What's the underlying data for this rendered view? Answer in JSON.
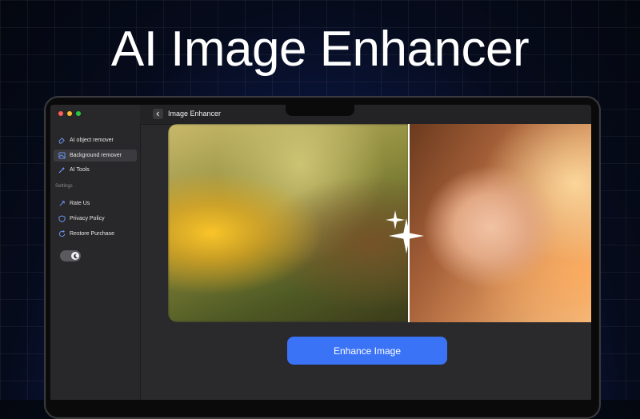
{
  "headline": "AI Image Enhancer",
  "sidebar": {
    "items": [
      {
        "label": "AI object remover",
        "icon": "eraser-icon"
      },
      {
        "label": "Background remover",
        "icon": "image-icon",
        "active": true
      },
      {
        "label": "AI Tools",
        "icon": "magic-wand-icon"
      }
    ],
    "section_label": "Settings",
    "settings_items": [
      {
        "label": "Rate Us",
        "icon": "rate-icon"
      },
      {
        "label": "Privacy Policy",
        "icon": "shield-icon"
      },
      {
        "label": "Restore Purchase",
        "icon": "restore-icon"
      }
    ],
    "theme_toggle": {
      "icon": "moon-icon",
      "state": "on"
    }
  },
  "topbar": {
    "title": "Image Enhancer",
    "back_icon": "chevron-left-icon"
  },
  "main": {
    "enhance_button": "Enhance Image"
  },
  "colors": {
    "accent": "#3b73f7",
    "traffic_red": "#ff5f57",
    "traffic_yellow": "#febc2e",
    "traffic_green": "#28c840"
  }
}
